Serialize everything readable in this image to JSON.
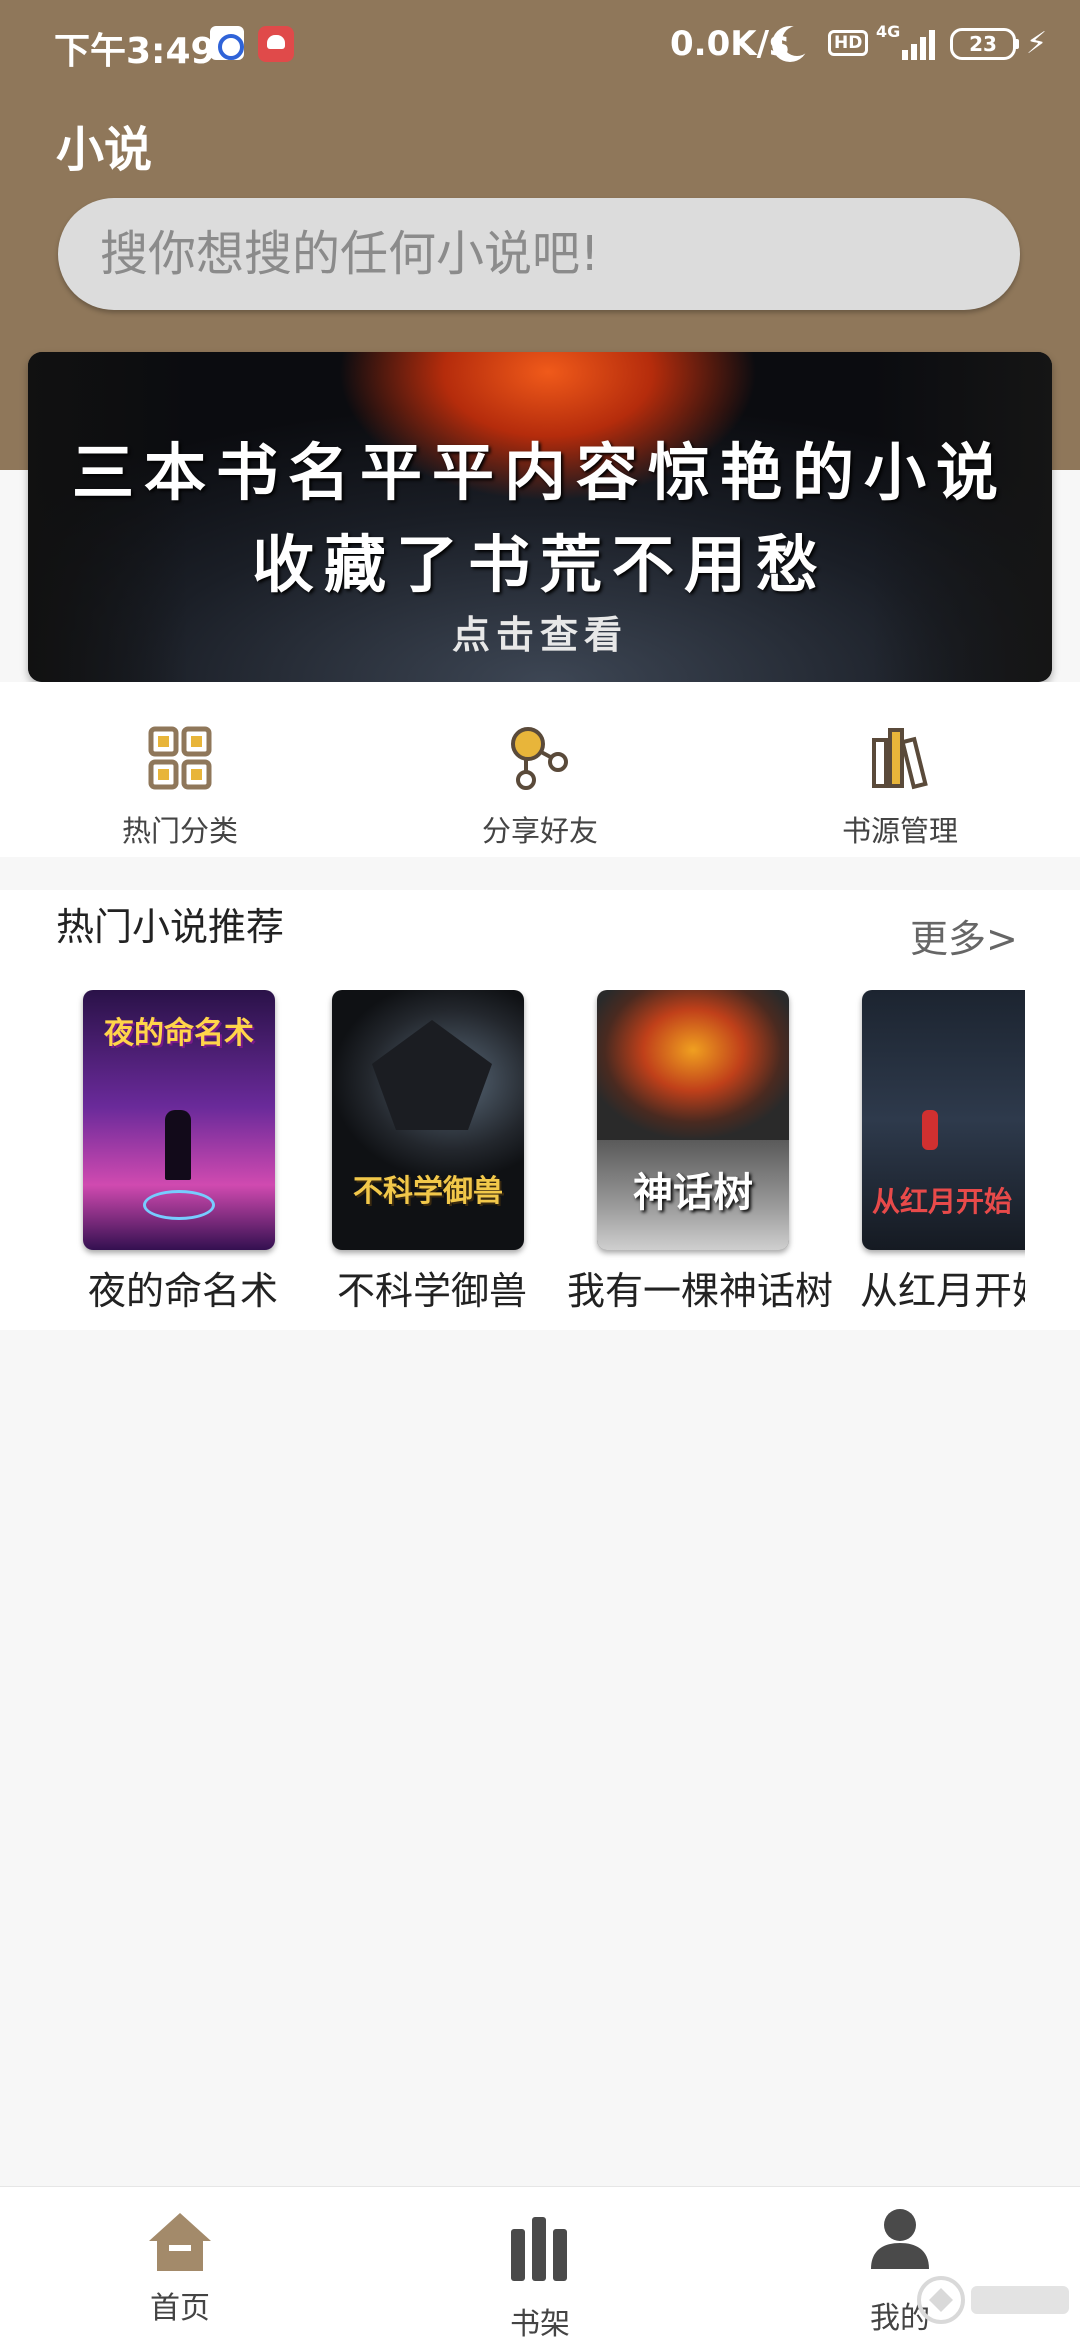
{
  "status_bar": {
    "time": "下午3:49",
    "speed": "0.0K/s",
    "hd": "HD",
    "network": "4G",
    "battery": "23"
  },
  "header": {
    "title": "小说",
    "search_placeholder": "搜你想搜的任何小说吧!"
  },
  "banner": {
    "line1": "三本书名平平内容惊艳的小说",
    "line2": "收藏了书荒不用愁",
    "cta": "点击查看"
  },
  "quick_menu": [
    {
      "label": "热门分类",
      "icon": "grid-icon"
    },
    {
      "label": "分享好友",
      "icon": "share-icon"
    },
    {
      "label": "书源管理",
      "icon": "books-icon"
    }
  ],
  "recommendations": {
    "title": "热门小说推荐",
    "more": "更多>",
    "books": [
      {
        "name": "夜的命名术",
        "cover_text": "夜的命名术"
      },
      {
        "name": "不科学御兽",
        "cover_text": "不科学御兽"
      },
      {
        "name": "我有一棵神话树",
        "cover_text": "神话树"
      },
      {
        "name": "从红月开始",
        "cover_text": "从红月开始"
      }
    ]
  },
  "bottom_nav": [
    {
      "label": "首页",
      "icon": "home-icon"
    },
    {
      "label": "书架",
      "icon": "bookshelf-icon"
    },
    {
      "label": "我的",
      "icon": "user-icon"
    }
  ],
  "colors": {
    "header_bg": "#8f775a",
    "accent": "#8f775a",
    "icon_dark": "#4a4a4a"
  }
}
